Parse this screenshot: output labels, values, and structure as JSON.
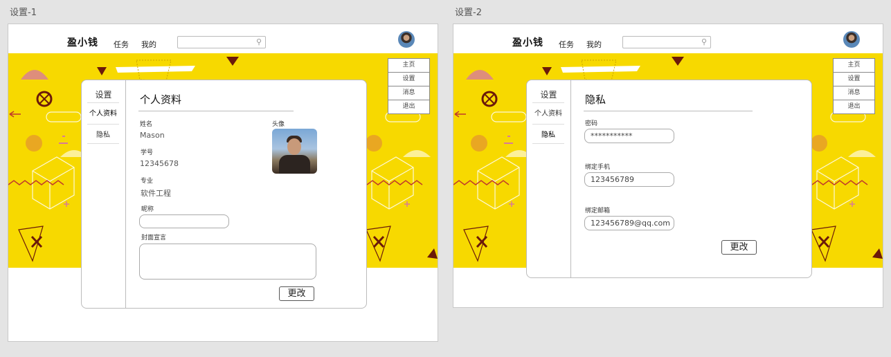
{
  "artboards": [
    {
      "title": "设置-1",
      "logo": "盈小钱",
      "nav": [
        "任务",
        "我的"
      ],
      "search_icon": "search-icon",
      "menu": [
        "主页",
        "设置",
        "消息",
        "退出"
      ],
      "side_title": "设置",
      "side_items": [
        "个人资料",
        "隐私"
      ],
      "section_title": "个人资料",
      "fields": {
        "name_label": "姓名",
        "name_value": "Mason",
        "id_label": "学号",
        "id_value": "12345678",
        "major_label": "专业",
        "major_value": "软件工程",
        "nickname_label": "昵称",
        "nickname_value": "",
        "motto_label": "封面宣言",
        "motto_value": "",
        "avatar_label": "头像"
      },
      "button": "更改"
    },
    {
      "title": "设置-2",
      "logo": "盈小钱",
      "nav": [
        "任务",
        "我的"
      ],
      "search_icon": "search-icon",
      "menu": [
        "主页",
        "设置",
        "消息",
        "退出"
      ],
      "side_title": "设置",
      "side_items": [
        "个人资料",
        "隐私"
      ],
      "section_title": "隐私",
      "fields": {
        "password_label": "密码",
        "password_value": "***********",
        "phone_label": "绑定手机",
        "phone_value": "123456789",
        "email_label": "绑定邮箱",
        "email_value": "123456789@qq.com"
      },
      "button": "更改"
    }
  ],
  "colors": {
    "banner": "#f7d900",
    "accent_dark": "#6b1a0a",
    "accent_pink": "#d77a9a"
  }
}
